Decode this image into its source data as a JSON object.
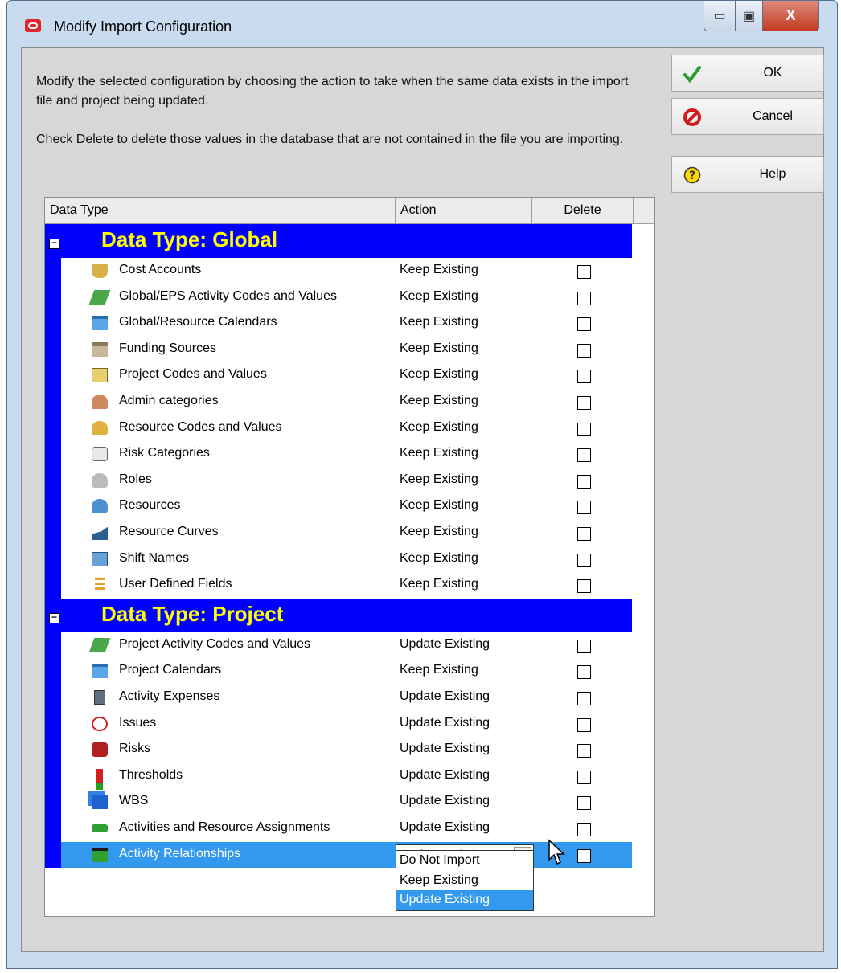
{
  "window": {
    "title": "Modify Import Configuration",
    "minimize_glyph": "▭",
    "maximize_glyph": "▣",
    "close_glyph": "X"
  },
  "instructions": {
    "line1": "Modify the selected configuration by choosing the action to take when the same data exists in the import file and project being updated.",
    "line2": "Check Delete to delete those values in the database that are not contained in the file you are importing."
  },
  "grid": {
    "columns": {
      "data_type": "Data Type",
      "action": "Action",
      "delete": "Delete"
    },
    "groups": [
      {
        "title": "Data Type: Global",
        "rows": [
          {
            "label": "Cost Accounts",
            "action": "Keep Existing",
            "icon": "cost-accounts-icon",
            "delete": false
          },
          {
            "label": "Global/EPS Activity Codes and Values",
            "action": "Keep Existing",
            "icon": "activity-codes-icon",
            "delete": false
          },
          {
            "label": "Global/Resource Calendars",
            "action": "Keep Existing",
            "icon": "calendar-icon",
            "delete": false
          },
          {
            "label": "Funding Sources",
            "action": "Keep Existing",
            "icon": "funding-icon",
            "delete": false
          },
          {
            "label": "Project Codes and Values",
            "action": "Keep Existing",
            "icon": "project-codes-icon",
            "delete": false
          },
          {
            "label": "Admin categories",
            "action": "Keep Existing",
            "icon": "admin-icon",
            "delete": false
          },
          {
            "label": "Resource Codes and Values",
            "action": "Keep Existing",
            "icon": "resource-codes-icon",
            "delete": false
          },
          {
            "label": "Risk Categories",
            "action": "Keep Existing",
            "icon": "risk-categories-icon",
            "delete": false
          },
          {
            "label": "Roles",
            "action": "Keep Existing",
            "icon": "roles-icon",
            "delete": false
          },
          {
            "label": "Resources",
            "action": "Keep Existing",
            "icon": "resources-icon",
            "delete": false
          },
          {
            "label": "Resource Curves",
            "action": "Keep Existing",
            "icon": "curves-icon",
            "delete": false
          },
          {
            "label": "Shift Names",
            "action": "Keep Existing",
            "icon": "shift-icon",
            "delete": false
          },
          {
            "label": "User Defined Fields",
            "action": "Keep Existing",
            "icon": "udf-icon",
            "delete": false
          }
        ]
      },
      {
        "title": "Data Type: Project",
        "rows": [
          {
            "label": "Project Activity Codes and Values",
            "action": "Update Existing",
            "icon": "activity-codes-icon",
            "delete": false
          },
          {
            "label": "Project Calendars",
            "action": "Keep Existing",
            "icon": "calendar-icon",
            "delete": false
          },
          {
            "label": "Activity Expenses",
            "action": "Update Existing",
            "icon": "expenses-icon",
            "delete": false
          },
          {
            "label": "Issues",
            "action": "Update Existing",
            "icon": "issues-icon",
            "delete": false
          },
          {
            "label": "Risks",
            "action": "Update Existing",
            "icon": "risks-icon",
            "delete": false
          },
          {
            "label": "Thresholds",
            "action": "Update Existing",
            "icon": "thresholds-icon",
            "delete": false
          },
          {
            "label": "WBS",
            "action": "Update Existing",
            "icon": "wbs-icon",
            "delete": false
          },
          {
            "label": "Activities and Resource Assignments",
            "action": "Update Existing",
            "icon": "activities-icon",
            "delete": false
          },
          {
            "label": "Activity Relationships",
            "action": "Update Existing",
            "icon": "relationships-icon",
            "delete": false,
            "selected": true
          }
        ]
      }
    ],
    "dropdown_options": [
      "Do Not Import",
      "Keep Existing",
      "Update Existing"
    ],
    "dropdown_selected": "Update Existing"
  },
  "buttons": {
    "ok": "OK",
    "cancel": "Cancel",
    "help": "Help"
  },
  "colors": {
    "group_header_bg": "#0000ff",
    "group_header_text": "#ffff00",
    "selection": "#3399ee"
  }
}
